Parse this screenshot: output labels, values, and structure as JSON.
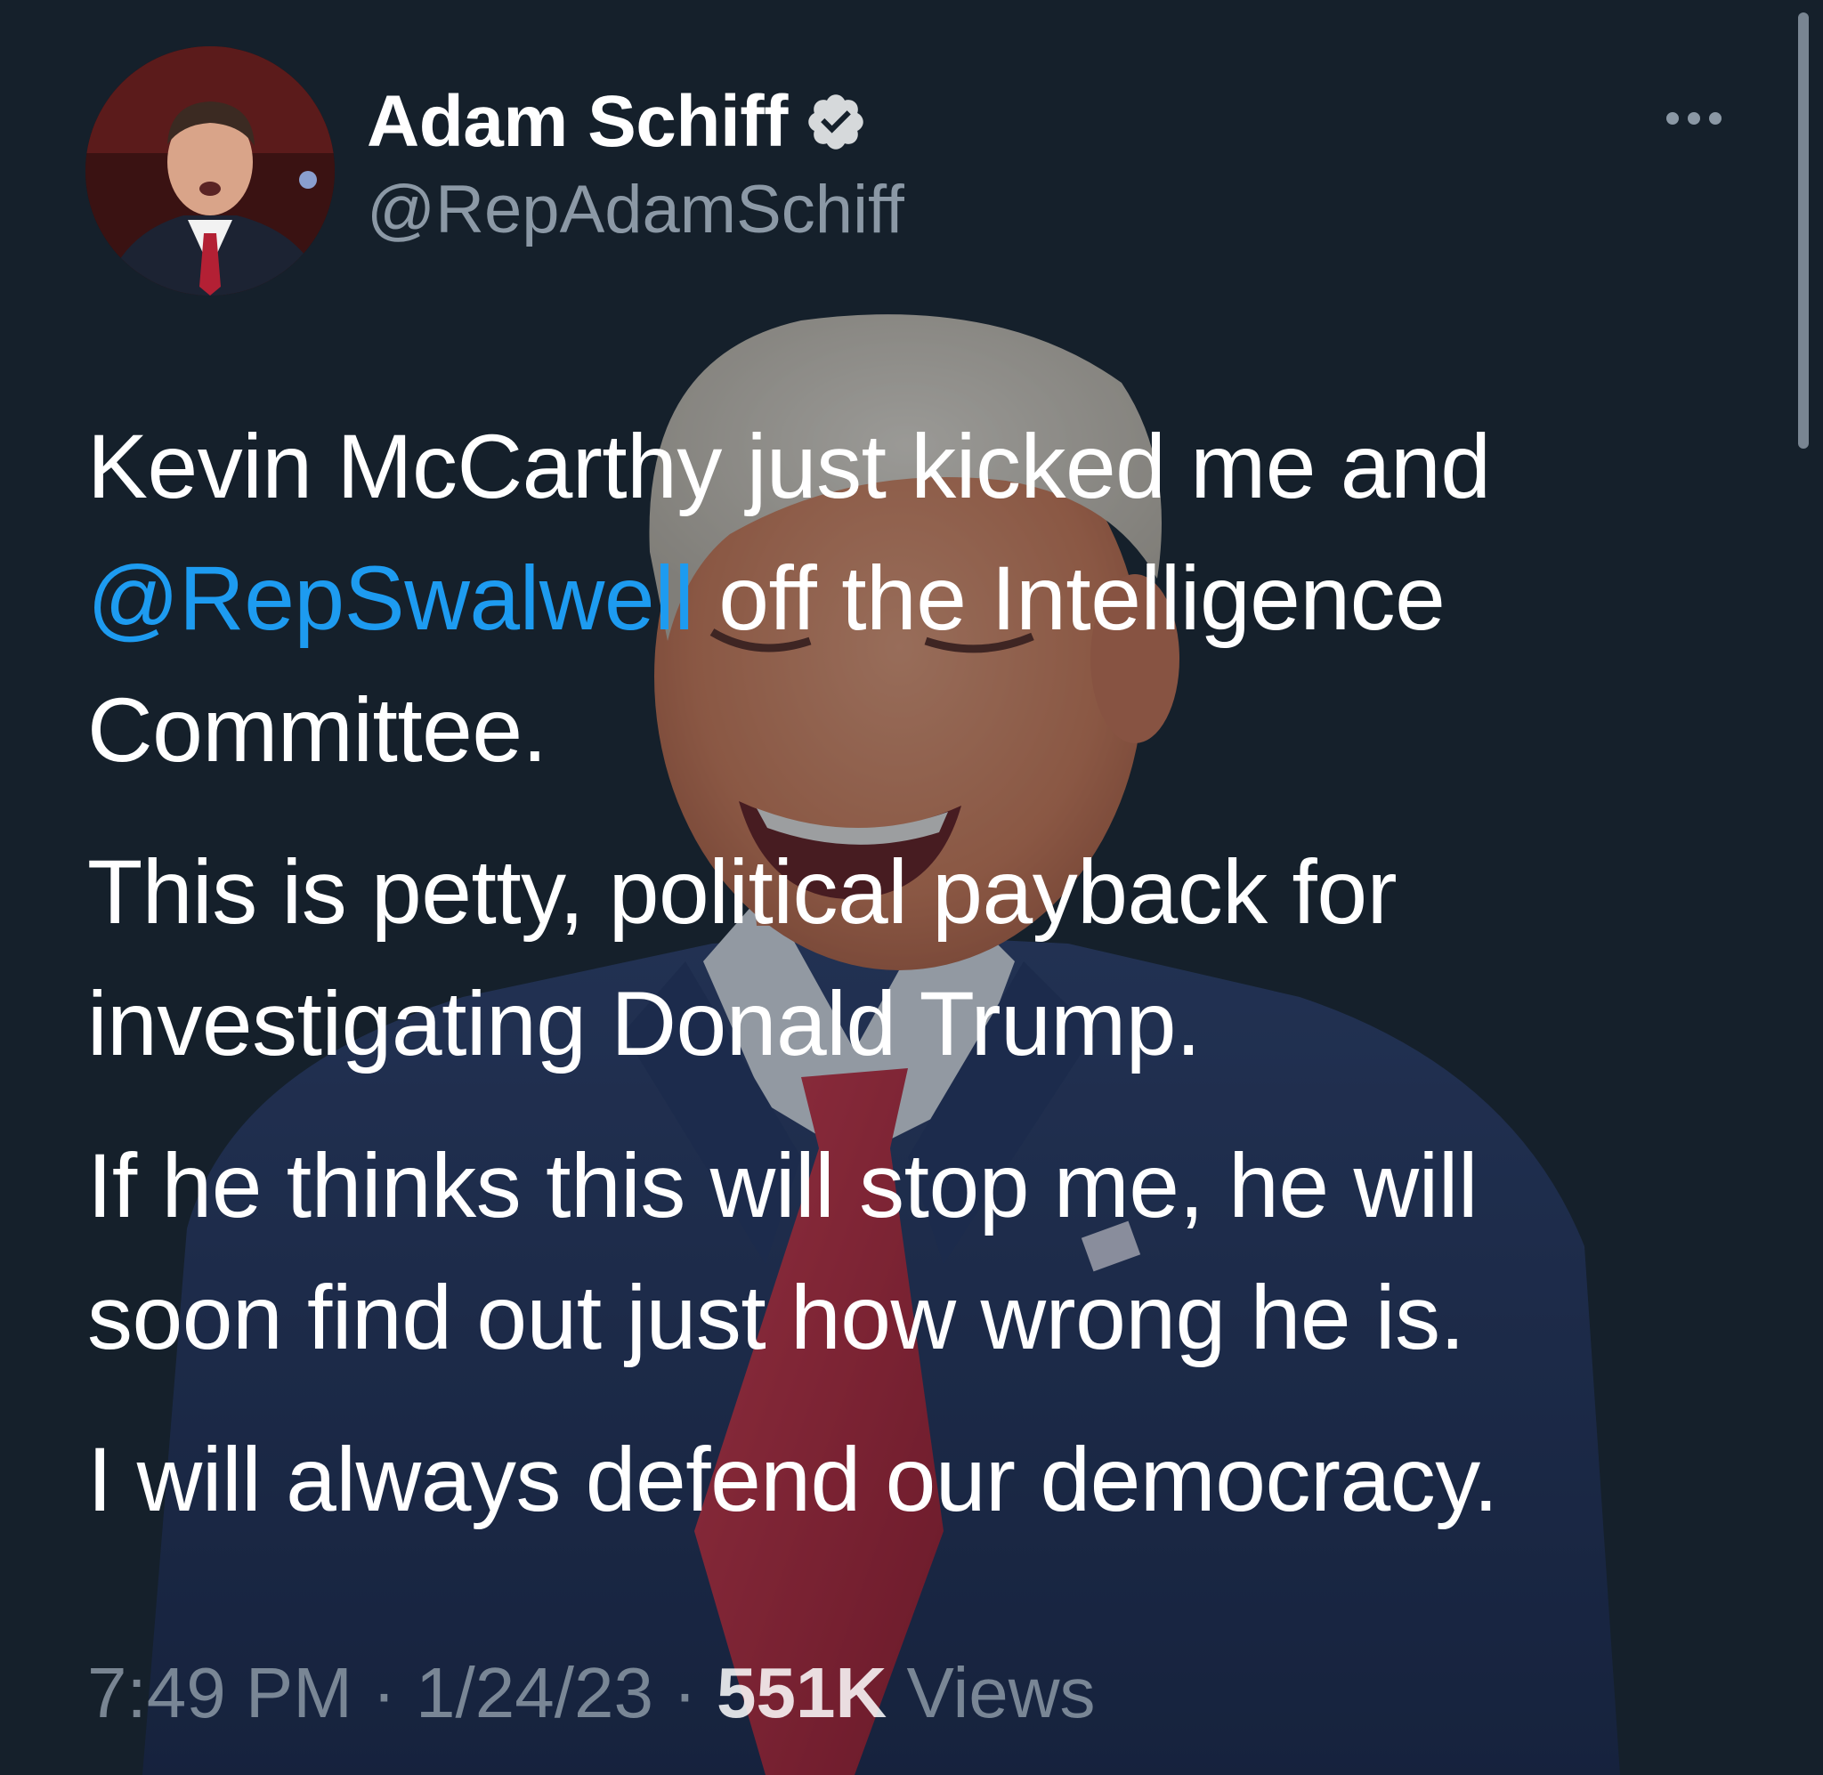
{
  "tweet": {
    "author": {
      "display_name": "Adam Schiff",
      "handle": "@RepAdamSchiff",
      "verified": true
    },
    "body": {
      "p1": {
        "line1": "Kevin McCarthy just kicked me and",
        "line2_mention": "@RepSwalwell",
        "line2_rest": " off the Intelligence",
        "line3": "Committee."
      },
      "p2": {
        "line1": "This is petty, political payback for",
        "line2": "investigating Donald Trump."
      },
      "p3": {
        "line1": "If he thinks this will stop me, he will",
        "line2": "soon find out just how wrong he is."
      },
      "p4": {
        "line1": "I will always defend our democracy."
      }
    },
    "meta": {
      "time": "7:49 PM",
      "sep1": " · ",
      "date": "1/24/23",
      "sep2": " · ",
      "views_count": "551K",
      "views_label": " Views"
    }
  },
  "colors": {
    "background": "#15202b",
    "text_primary": "#ffffff",
    "text_secondary": "#8b98a5",
    "link": "#1d9bf0"
  },
  "icons": {
    "verified": "verified-badge-icon",
    "more": "more-options-icon"
  }
}
